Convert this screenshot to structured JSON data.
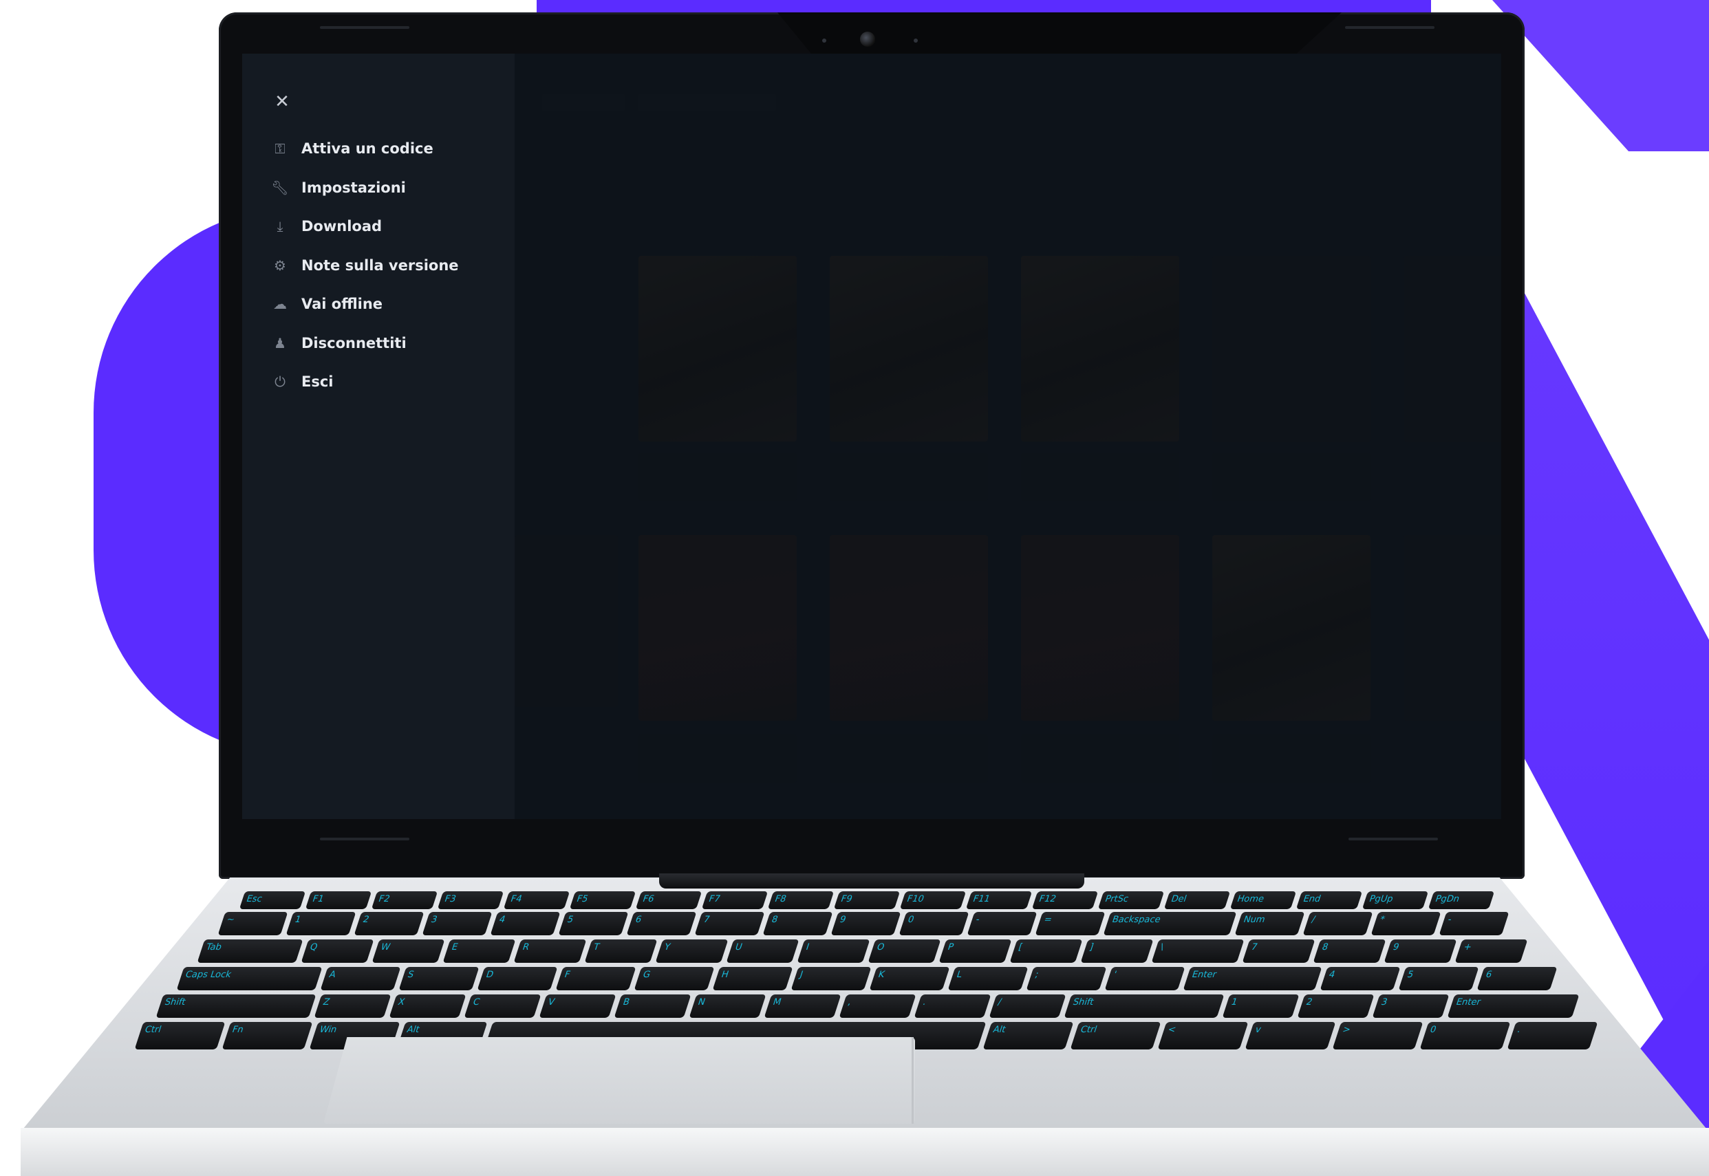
{
  "menu": {
    "close_icon": "close-icon",
    "items": [
      {
        "label": "Attiva un codice",
        "icon": "key-icon"
      },
      {
        "label": "Impostazioni",
        "icon": "wrench-icon"
      },
      {
        "label": "Download",
        "icon": "download-icon"
      },
      {
        "label": "Note sulla versione",
        "icon": "gear-icon"
      },
      {
        "label": "Vai offline",
        "icon": "cloud-off-icon"
      },
      {
        "label": "Disconnettiti",
        "icon": "user-icon"
      },
      {
        "label": "Esci",
        "icon": "power-icon"
      }
    ]
  },
  "keyboard": {
    "rows": [
      [
        "Esc",
        "F1",
        "F2",
        "F3",
        "F4",
        "F5",
        "F6",
        "F7",
        "F8",
        "F9",
        "F10",
        "F11",
        "F12",
        "PrtSc",
        "Del",
        "Home",
        "End",
        "PgUp",
        "PgDn"
      ],
      [
        "~",
        "1",
        "2",
        "3",
        "4",
        "5",
        "6",
        "7",
        "8",
        "9",
        "0",
        "-",
        "=",
        "Backspace",
        "Num",
        "/",
        "*",
        "-"
      ],
      [
        "Tab",
        "Q",
        "W",
        "E",
        "R",
        "T",
        "Y",
        "U",
        "I",
        "O",
        "P",
        "[",
        "]",
        "\\",
        "7",
        "8",
        "9",
        "+"
      ],
      [
        "Caps Lock",
        "A",
        "S",
        "D",
        "F",
        "G",
        "H",
        "J",
        "K",
        "L",
        ";",
        "'",
        "Enter",
        "4",
        "5",
        "6"
      ],
      [
        "Shift",
        "Z",
        "X",
        "C",
        "V",
        "B",
        "N",
        "M",
        ",",
        ".",
        "/",
        "Shift",
        "1",
        "2",
        "3",
        "Enter"
      ],
      [
        "Ctrl",
        "Fn",
        "Win",
        "Alt",
        "",
        "Alt",
        "Ctrl",
        "<",
        "v",
        ">",
        "0",
        "."
      ]
    ]
  },
  "colors": {
    "accent": "#5b2cff",
    "key_legend": "#18b8d8",
    "menu_bg": "#141a22"
  }
}
